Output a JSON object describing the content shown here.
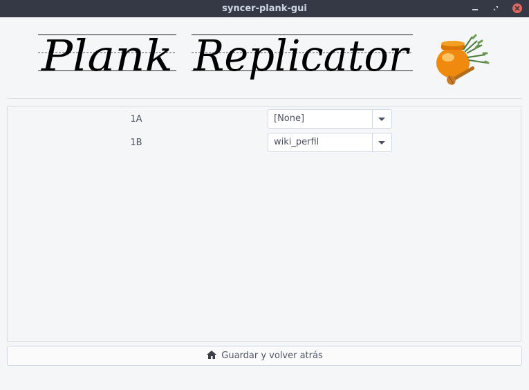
{
  "window": {
    "title": "syncer-plank-gui"
  },
  "header": {
    "banner_text": "Plank Replicator",
    "logo_icon": "honey-pot-icon"
  },
  "rows": [
    {
      "label": "1A",
      "selected": "[None]"
    },
    {
      "label": "1B",
      "selected": "wiki_perfil"
    }
  ],
  "footer": {
    "button_label": "Guardar y volver atrás",
    "button_icon": "home-icon"
  },
  "colors": {
    "titlebar": "#353945",
    "close_button": "#e0675e",
    "background": "#f5f6f7"
  }
}
